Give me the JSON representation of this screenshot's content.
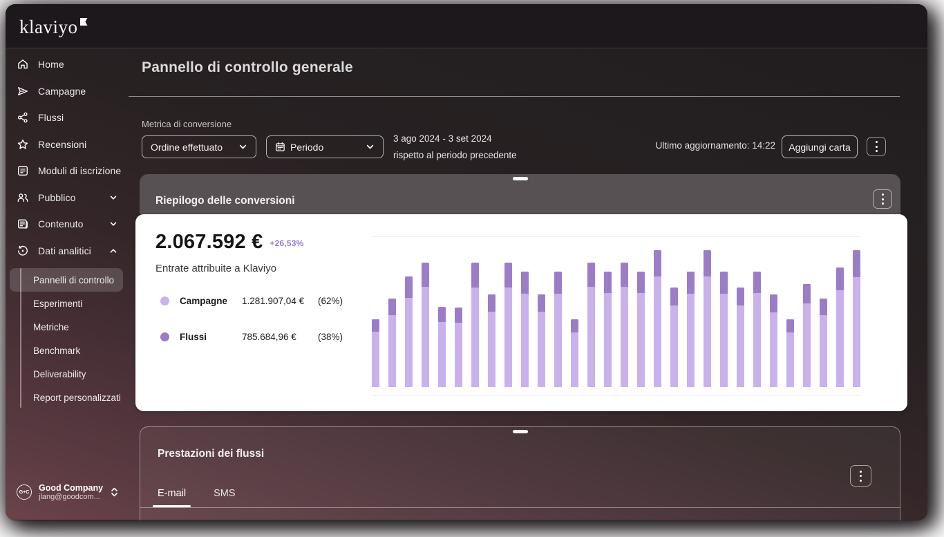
{
  "window": {
    "logo": "klaviyo"
  },
  "sidebar": {
    "items": [
      {
        "label": "Home",
        "icon": "home-icon"
      },
      {
        "label": "Campagne",
        "icon": "send-icon"
      },
      {
        "label": "Flussi",
        "icon": "share-nodes-icon"
      },
      {
        "label": "Recensioni",
        "icon": "star-icon"
      },
      {
        "label": "Moduli di iscrizione",
        "icon": "form-icon"
      },
      {
        "label": "Pubblico",
        "icon": "people-icon",
        "chevron": "down"
      },
      {
        "label": "Contenuto",
        "icon": "content-icon",
        "chevron": "down"
      },
      {
        "label": "Dati analitici",
        "icon": "analytics-icon",
        "chevron": "up",
        "expanded": true
      }
    ],
    "subitems": [
      "Pannelli di controllo",
      "Esperimenti",
      "Metriche",
      "Benchmark",
      "Deliverability",
      "Report personalizzati"
    ],
    "selected_subitem": "Pannelli di controllo",
    "account": {
      "initials": "G+C",
      "name": "Good Company",
      "email": "jlang@goodcom..."
    }
  },
  "header": {
    "title": "Pannello di controllo generale"
  },
  "controls": {
    "metric_label": "Metrica di conversione",
    "metric_value": "Ordine effettuato",
    "period_value": "Periodo",
    "date_range": "3 ago 2024 - 3 set 2024",
    "date_compare": "rispetto al periodo precedente",
    "last_updated": "Ultimo aggiornamento: 14:22",
    "add_card_label": "Aggiungi carta"
  },
  "conversion_card": {
    "title": "Riepilogo delle conversioni",
    "total": "2.067.592 €",
    "delta": "+26,53%",
    "subtitle": "Entrate attribuite a Klaviyo",
    "legend": [
      {
        "name": "Campagne",
        "value": "1.281.907,04 €",
        "percent": "(62%)",
        "color": "#c9b2ec"
      },
      {
        "name": "Flussi",
        "value": "785.684,96 €",
        "percent": "(38%)",
        "color": "#9b7dc7"
      }
    ]
  },
  "chart_data": {
    "type": "bar",
    "stacked": true,
    "title": "Entrate attribuite a Klaviyo",
    "total_label": "2.067.592 €",
    "delta_label": "+26,53%",
    "x_range": "3 ago 2024 - 3 set 2024 (un bar per giorno, etichette assi nascoste)",
    "legend_position": "left",
    "grid": "faint top and bottom lines only",
    "values_are_relative_heights_px": true,
    "ylim": [
      0,
      218
    ],
    "series": [
      {
        "name": "Campagne",
        "color": "#c9b2ec",
        "share": "62%",
        "total": "1.281.907,04 €",
        "values": [
          80,
          104,
          129,
          145,
          94,
          93,
          144,
          109,
          144,
          135,
          109,
          135,
          79,
          145,
          136,
          145,
          136,
          160,
          118,
          135,
          160,
          135,
          118,
          136,
          108,
          79,
          121,
          104,
          140,
          159
        ]
      },
      {
        "name": "Flussi",
        "color": "#9b7dc7",
        "share": "38%",
        "total": "785.684,96 €",
        "values": [
          18,
          24,
          31,
          35,
          22,
          22,
          36,
          25,
          36,
          32,
          25,
          32,
          19,
          35,
          31,
          35,
          31,
          38,
          26,
          32,
          38,
          32,
          26,
          31,
          26,
          19,
          28,
          24,
          33,
          39
        ]
      }
    ]
  },
  "flows_card": {
    "title": "Prestazioni dei flussi",
    "tabs": [
      "E-mail",
      "SMS"
    ],
    "active_tab": "E-mail"
  },
  "colors": {
    "campagne": "#c9b2ec",
    "flussi": "#9b7dc7",
    "delta_text": "#9577d1",
    "card_header": "#585153",
    "sidebar_bottom": "#6b434b",
    "background_top": "#211d1f"
  }
}
